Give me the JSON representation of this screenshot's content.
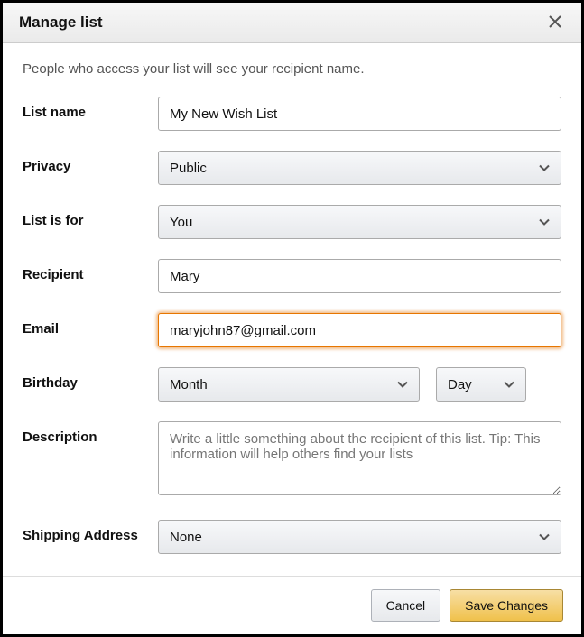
{
  "header": {
    "title": "Manage list"
  },
  "note": "People who access your list will see your recipient name.",
  "form": {
    "list_name": {
      "label": "List name",
      "value": "My New Wish List"
    },
    "privacy": {
      "label": "Privacy",
      "value": "Public"
    },
    "list_is_for": {
      "label": "List is for",
      "value": "You"
    },
    "recipient": {
      "label": "Recipient",
      "value": "Mary"
    },
    "email": {
      "label": "Email",
      "value": "maryjohn87@gmail.com"
    },
    "birthday": {
      "label": "Birthday",
      "month": "Month",
      "day": "Day"
    },
    "description": {
      "label": "Description",
      "placeholder": "Write a little something about the recipient of this list. Tip: This information will help others find your lists",
      "value": ""
    },
    "shipping": {
      "label": "Shipping Address",
      "value": "None"
    }
  },
  "footer": {
    "cancel": "Cancel",
    "save": "Save Changes"
  }
}
